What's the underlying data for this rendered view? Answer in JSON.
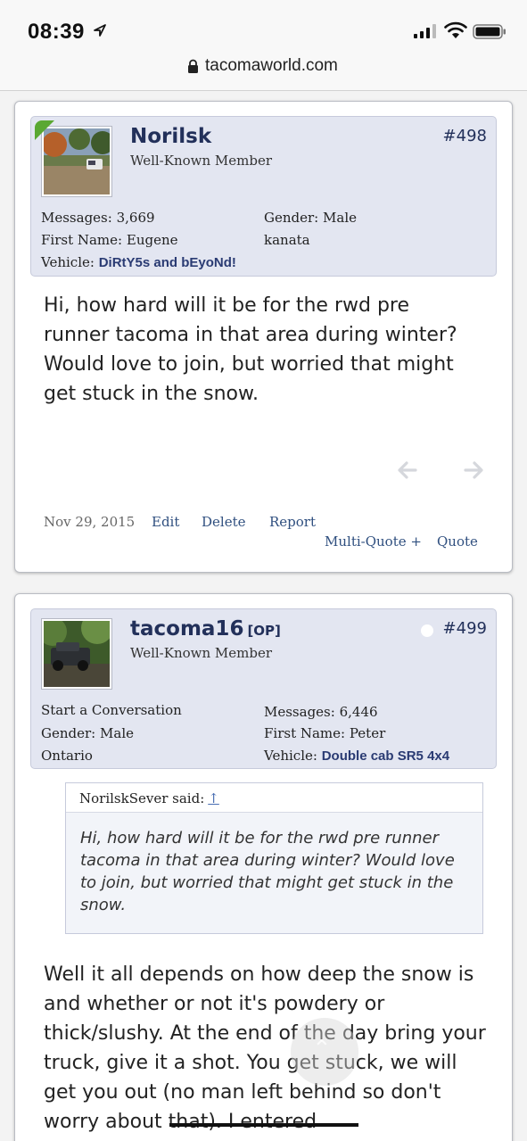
{
  "status_bar": {
    "time": "08:39"
  },
  "browser": {
    "url": "tacomaworld.com"
  },
  "posts": [
    {
      "username": "Norilsk",
      "op_tag": "",
      "user_title": "Well-Known Member",
      "post_number": "#498",
      "left_info": [
        {
          "label": "Messages:",
          "value": "3,669"
        },
        {
          "label": "First Name:",
          "value": "Eugene"
        },
        {
          "label": "Vehicle:",
          "value": "DiRtY5s and bEyoNd!"
        }
      ],
      "right_info": [
        {
          "label": "Gender:",
          "value": "Male"
        },
        {
          "label": "",
          "value": "kanata"
        }
      ],
      "message": "Hi, how hard will it be for the rwd pre runner tacoma in that area during winter? Would love to join, but worried that might get stuck in the snow.",
      "date": "Nov 29, 2015",
      "actions": {
        "edit": "Edit",
        "delete": "Delete",
        "report": "Report",
        "multiquote": "Multi-Quote +",
        "quote": "Quote"
      }
    },
    {
      "username": "tacoma16",
      "op_tag": "[OP]",
      "user_title": "Well-Known Member",
      "post_number": "#499",
      "left_info": [
        {
          "label": "Start a Conversation",
          "value": ""
        },
        {
          "label": "Gender:",
          "value": "Male"
        },
        {
          "label": "",
          "value": "Ontario"
        }
      ],
      "right_info": [
        {
          "label": "Messages:",
          "value": "6,446"
        },
        {
          "label": "First Name:",
          "value": "Peter"
        },
        {
          "label": "Vehicle:",
          "value": "Double cab SR5 4x4"
        }
      ],
      "quote": {
        "author": "NorilskSever said:",
        "up_glyph": "↑",
        "text": "Hi, how hard will it be for the rwd pre runner tacoma in that area during winter? Would love to join, but worried that might get stuck in the snow."
      },
      "message": "Well it all depends on how deep the snow is and whether or not it's powdery or thick/slushy. At the end of the day bring your truck, give it a shot. You get stuck, we will get you out (no man left behind so don't worry about that). I entered"
    }
  ],
  "icons": {
    "location": "location-arrow-icon",
    "signal": "cellular-signal-icon",
    "wifi": "wifi-icon",
    "battery": "battery-icon",
    "lock": "lock-icon",
    "prev": "arrow-left-icon",
    "next": "arrow-right-icon",
    "scroll_up": "chevron-up-icon"
  },
  "colors": {
    "accent": "#22305a",
    "vehicle": "#2a3b73",
    "link": "#2f4f7f",
    "userbox": "#e3e6f1"
  }
}
